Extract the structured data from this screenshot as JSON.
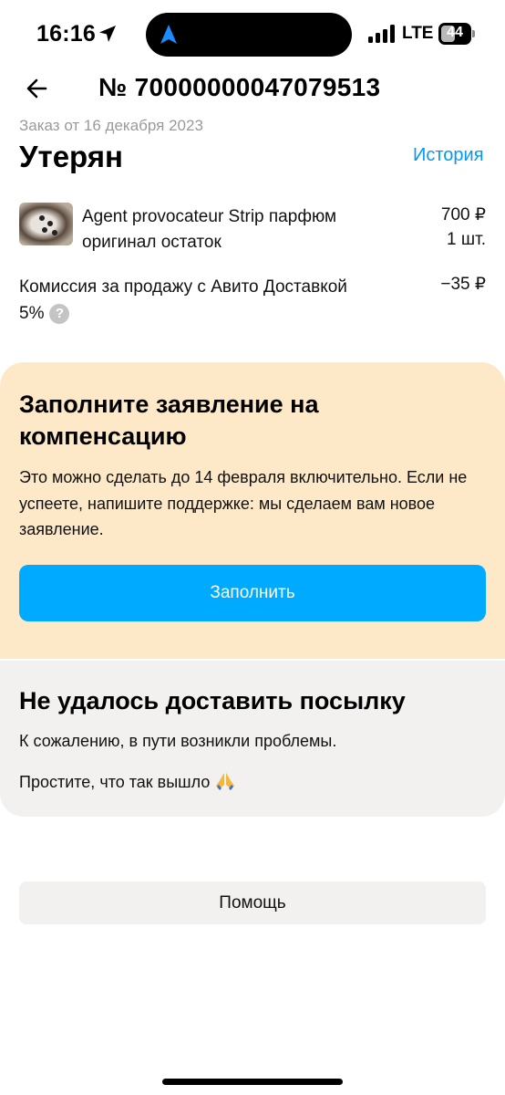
{
  "status_bar": {
    "time": "16:16",
    "network": "LTE",
    "battery": "44",
    "icons": [
      "location-arrow-icon",
      "navigation-icon",
      "signal-icon",
      "battery-icon"
    ]
  },
  "header": {
    "back_icon": "arrow-left-icon",
    "order_number": "№ 70000000047079513",
    "order_date": "Заказ от 16 декабря 2023",
    "status": "Утерян",
    "history_link": "История"
  },
  "product": {
    "name": "Agent provocateur Strip парфюм оригинал остаток",
    "price": "700 ₽",
    "quantity": "1 шт."
  },
  "commission": {
    "label": "Комиссия за продажу с Авито Доставкой 5%",
    "help_icon": "question-circle-icon",
    "value": "−35 ₽"
  },
  "compensation": {
    "title": "Заполните заявление на компенсацию",
    "text": "Это можно сделать до 14 февраля включительно. Если не успеете, напишите поддержке: мы сделаем вам новое заявление.",
    "button": "Заполнить"
  },
  "delivery_failed": {
    "title": "Не удалось доставить посылку",
    "text1": "К сожалению, в пути возникли проблемы.",
    "text2": "Простите, что так вышло",
    "emoji_icon": "folded-hands-icon"
  },
  "help_button": "Помощь",
  "colors": {
    "accent": "#00aaff",
    "link": "#0099f7",
    "compensation_bg": "#fde9c7",
    "card_bg": "#f2f1f0",
    "muted_text": "#9a9a9a"
  }
}
